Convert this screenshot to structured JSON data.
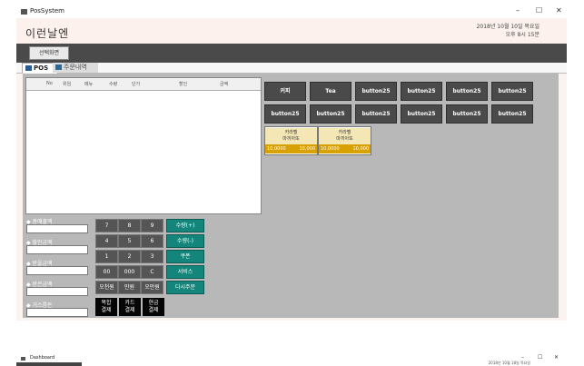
{
  "window": {
    "title": "PosSystem",
    "controls": {
      "minimize": "–",
      "maximize": "☐",
      "close": "✕"
    }
  },
  "header": {
    "app_name": "이런날엔",
    "date": "2018년 10월 10일 목요일",
    "time": "오후 8시 15분"
  },
  "toolbar": {
    "button_label": "선택화면"
  },
  "tabs": [
    {
      "label": "POS",
      "active": true
    },
    {
      "label": "주문내역",
      "active": false
    }
  ],
  "grid": {
    "columns": [
      "No",
      "위임",
      "메뉴",
      "수량",
      "단가",
      "할인",
      "금액"
    ]
  },
  "payment_fields": [
    {
      "label": "◆ 총매출액",
      "value": ""
    },
    {
      "label": "◆ 할인금액",
      "value": ""
    },
    {
      "label": "◆ 받을금액",
      "value": ""
    },
    {
      "label": "◆ 받은금액",
      "value": ""
    },
    {
      "label": "◆ 거스름돈",
      "value": ""
    }
  ],
  "keypad": {
    "rows": [
      [
        "7",
        "8",
        "9"
      ],
      [
        "4",
        "5",
        "6"
      ],
      [
        "1",
        "2",
        "3"
      ],
      [
        "00",
        "000",
        "C"
      ],
      [
        "오천원",
        "만원",
        "오만원"
      ]
    ],
    "side": [
      "수량(+)",
      "수량(-)",
      "쿠폰",
      "서비스",
      "다시주문"
    ],
    "pay": [
      {
        "line1": "복합",
        "line2": "결제"
      },
      {
        "line1": "카드",
        "line2": "결제"
      },
      {
        "line1": "현금",
        "line2": "결제"
      }
    ]
  },
  "menu_buttons": [
    [
      "커피",
      "Tea",
      "button25",
      "button25",
      "button25",
      "button25"
    ],
    [
      "button25",
      "button25",
      "button25",
      "button25",
      "button25",
      "button25"
    ]
  ],
  "items": [
    {
      "name1": "카라멜",
      "name2": "마끼아또",
      "price_left": "10,0000",
      "price_right": "10,000"
    },
    {
      "name1": "카라멜",
      "name2": "마끼아또",
      "price_left": "10,0000",
      "price_right": "10,000"
    }
  ],
  "second_window": {
    "title": "Dashboard",
    "date": "2018년 10월 18일 목요일"
  }
}
